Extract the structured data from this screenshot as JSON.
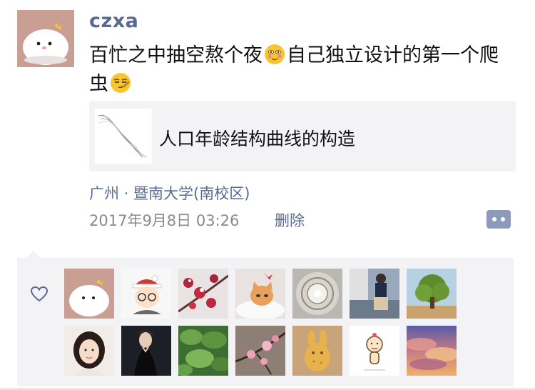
{
  "post": {
    "username": "czxa",
    "text_part1": "百忙之中抽空熬个夜",
    "text_part2": "自己独立设计的第一个爬虫",
    "emoji1": "blush-emoji-icon",
    "emoji2": "smirk-emoji-icon",
    "link_title": "人口年龄结构曲线的构造",
    "location": "广州 · 暨南大学(南校区)",
    "timestamp": "2017年9月8日 03:26",
    "delete_label": "删除"
  },
  "likes": {
    "icon": "heart-outline-icon",
    "avatars": [
      {
        "icon": "dumpling-avatar-icon",
        "bg": "#c99e93"
      },
      {
        "icon": "cartoon-boy-santa-hat-icon",
        "bg": "#f7f7f7"
      },
      {
        "icon": "red-flowers-snow-icon",
        "bg": "#e9e3e3"
      },
      {
        "icon": "kitten-icon",
        "bg": "#e8e3e0"
      },
      {
        "icon": "dome-ceiling-icon",
        "bg": "#b9b7b2"
      },
      {
        "icon": "street-figure-icon",
        "bg": "#9aa8bb"
      },
      {
        "icon": "tree-icon",
        "bg": "#9cb86a"
      },
      {
        "icon": "girl-portrait-icon",
        "bg": "#f2ece8"
      },
      {
        "icon": "woman-dark-dress-icon",
        "bg": "#1d1f26"
      },
      {
        "icon": "lotus-leaves-icon",
        "bg": "#3d6d32"
      },
      {
        "icon": "plum-blossom-icon",
        "bg": "#8d7e76"
      },
      {
        "icon": "bunny-cookie-icon",
        "bg": "#c9a37a"
      },
      {
        "icon": "cartoon-doodle-icon",
        "bg": "#ffffff"
      },
      {
        "icon": "sunset-clouds-icon",
        "bg": "#6a5fa0"
      }
    ]
  }
}
